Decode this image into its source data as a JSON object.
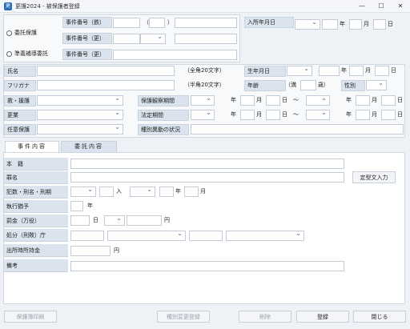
{
  "window": {
    "title": "更護2024 - 被保護者登録",
    "icon": "app-icon",
    "controls": [
      "—",
      "☐",
      "✕"
    ]
  },
  "top": {
    "radio_entrusted": "委託保護",
    "radio_former": "準義補導委託",
    "case_no_jaku": "事件番号（鉄）",
    "case_no_kou": "事件番号（更）",
    "case_no_kou2": "事件番号（更）",
    "paren_open": "（",
    "paren_close": "）",
    "admission_date": "入所年月日",
    "year": "年",
    "month": "月",
    "day": "日"
  },
  "person": {
    "name_label": "氏名",
    "name_hint": "（全角20文字）",
    "kana_label": "フリガナ",
    "kana_hint": "（半角20文字）",
    "birth_label": "生年月日",
    "age_label": "年齢",
    "age_prefix": "（満",
    "age_suffix": "歳）",
    "gender_label": "性別",
    "relief_label": "救・援護",
    "probation_label": "保護観察期間",
    "kouchou_label": "更業",
    "legal_label": "法定期間",
    "voluntary_label": "任意保護",
    "special_label": "種別異動の状況",
    "year": "年",
    "month": "月",
    "day": "日",
    "tilde": "～"
  },
  "tabs": [
    {
      "label": "事件内容",
      "active": true
    },
    {
      "label": "委託内容",
      "active": false
    }
  ],
  "case": {
    "main_label": "本　籍",
    "crime_label": "罪名",
    "template_button": "定型文入力",
    "prior_label": "犯数・刑名・刑期",
    "in": "入",
    "year": "年",
    "month": "月",
    "suspension_label": "執行猶予",
    "fine_label": "罰金（万役）",
    "day": "日",
    "yen": "円",
    "court_label": "処分（刑敗）庁",
    "release_label": "出所時所持金",
    "remarks_label": "備考"
  },
  "footer": {
    "print_button": "保護簿印刷",
    "change_button": "種別変更登録",
    "delete_button": "削除",
    "register_button": "登録",
    "close_button": "閉じる"
  }
}
